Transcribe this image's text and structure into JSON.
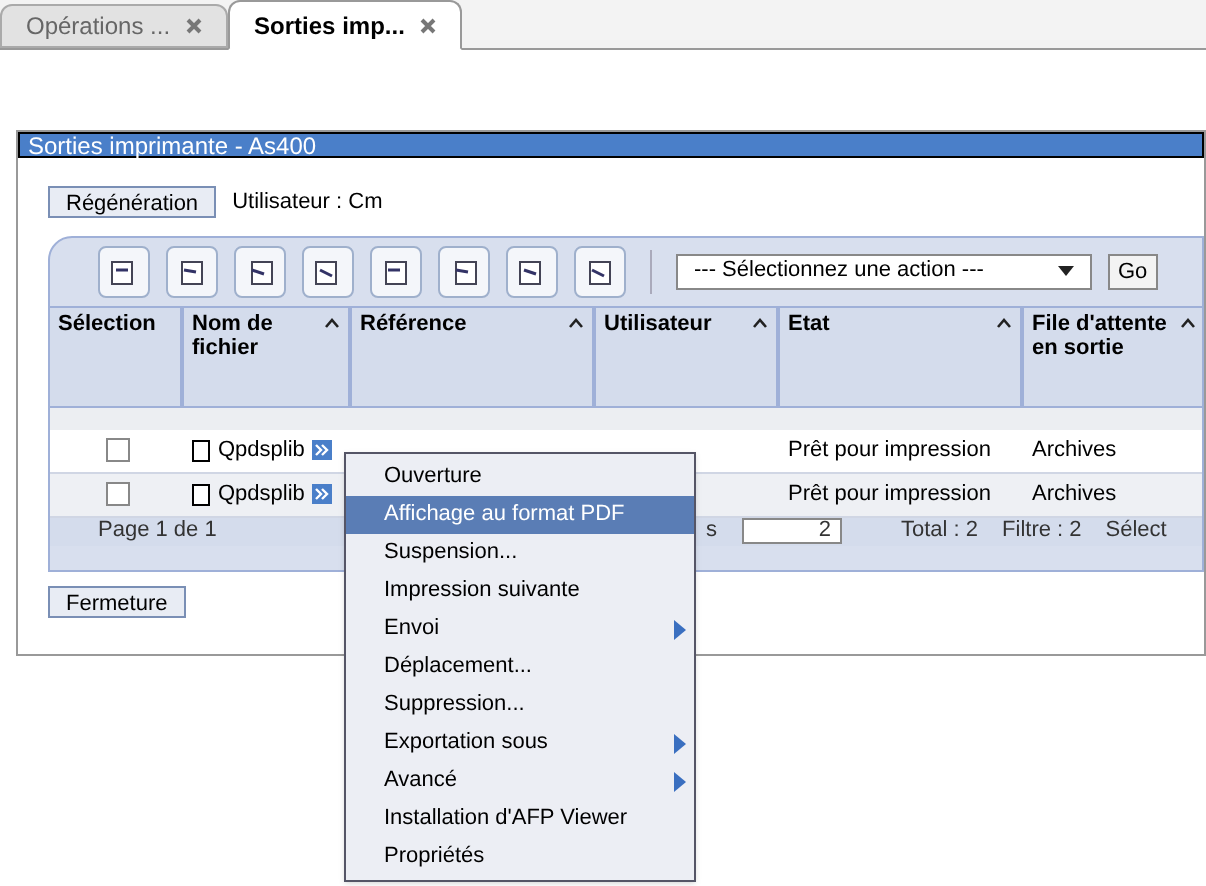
{
  "tabs": [
    {
      "label": "Opérations ...",
      "selected": false
    },
    {
      "label": "Sorties imp...",
      "selected": true
    }
  ],
  "panel": {
    "title": "Sorties imprimante - As400",
    "refresh_button": "Régénération",
    "user_label": "Utilisateur : Cm",
    "close_button": "Fermeture"
  },
  "toolbar": {
    "action_select": "--- Sélectionnez une action ---",
    "go_button": "Go"
  },
  "table": {
    "columns": [
      {
        "label": "Sélection",
        "sortable": false
      },
      {
        "label": "Nom de fichier",
        "sortable": true
      },
      {
        "label": "Référence",
        "sortable": true
      },
      {
        "label": "Utilisateur",
        "sortable": true
      },
      {
        "label": "Etat",
        "sortable": true
      },
      {
        "label": "File d'attente en sortie",
        "sortable": true
      }
    ],
    "rows": [
      {
        "checked": false,
        "file": "Qpdsplib",
        "reference": "",
        "user": "",
        "state": "Prêt pour impression",
        "queue": "Archives"
      },
      {
        "checked": false,
        "file": "Qpdsplib",
        "reference": "",
        "user": "",
        "state": "Prêt pour impression",
        "queue": "Archives"
      }
    ]
  },
  "pagination": {
    "page": "Page 1 de 1",
    "rows_label_end": "s",
    "rows_value": "2",
    "total": "Total : 2",
    "filter": "Filtre : 2",
    "selected": "Sélect"
  },
  "context_menu": [
    {
      "label": "Ouverture",
      "selected": false,
      "submenu": false
    },
    {
      "label": "Affichage au format PDF",
      "selected": true,
      "submenu": false
    },
    {
      "label": "Suspension...",
      "selected": false,
      "submenu": false
    },
    {
      "label": "Impression suivante",
      "selected": false,
      "submenu": false
    },
    {
      "label": "Envoi",
      "selected": false,
      "submenu": true
    },
    {
      "label": "Déplacement...",
      "selected": false,
      "submenu": false
    },
    {
      "label": "Suppression...",
      "selected": false,
      "submenu": false
    },
    {
      "label": "Exportation sous",
      "selected": false,
      "submenu": true
    },
    {
      "label": "Avancé",
      "selected": false,
      "submenu": true
    },
    {
      "label": "Installation d'AFP Viewer",
      "selected": false,
      "submenu": false
    },
    {
      "label": "Propriétés",
      "selected": false,
      "submenu": false
    }
  ]
}
